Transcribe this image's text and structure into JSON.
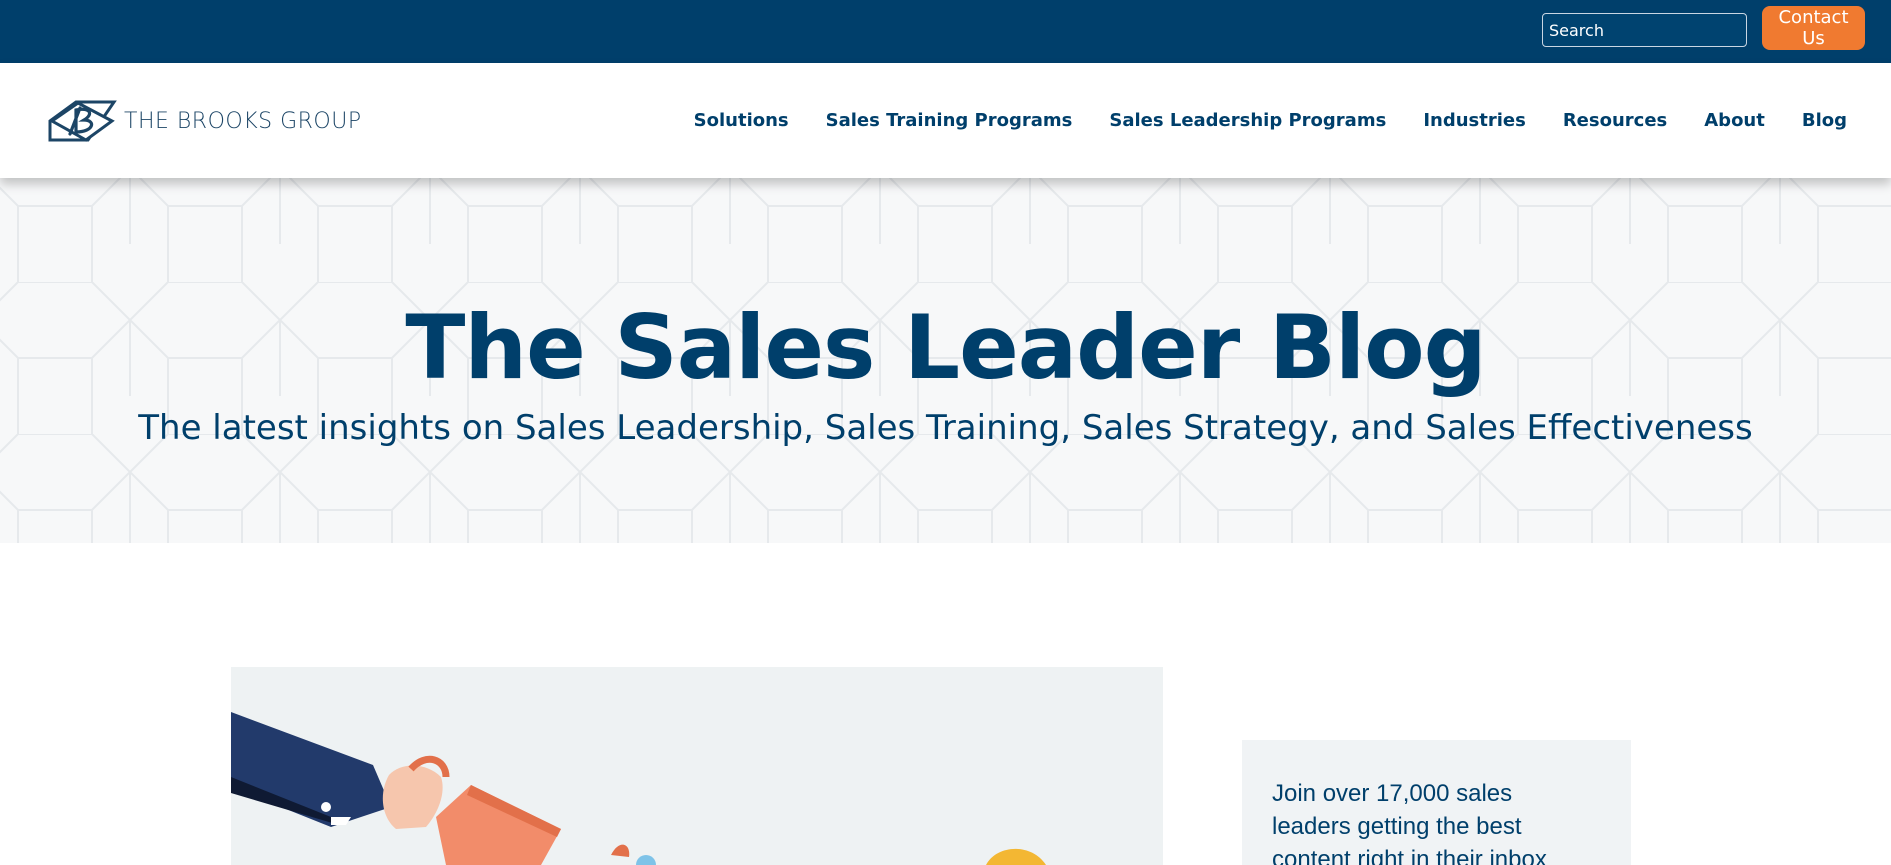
{
  "topbar": {
    "search_placeholder": "Search",
    "contact_label": "Contact Us"
  },
  "header": {
    "logo_text": "THE BROOKS GROUP",
    "nav": [
      "Solutions",
      "Sales Training Programs",
      "Sales Leadership Programs",
      "Industries",
      "Resources",
      "About",
      "Blog"
    ]
  },
  "hero": {
    "title": "The Sales Leader Blog",
    "subtitle": "The latest insights on Sales Leadership, Sales Training, Sales Strategy, and Sales Effectiveness"
  },
  "sidebar": {
    "newsletter_text": "Join over 17,000 sales leaders getting the best content right in their inbox"
  },
  "colors": {
    "brand_navy": "#003f6b",
    "accent_orange": "#f07a30"
  }
}
